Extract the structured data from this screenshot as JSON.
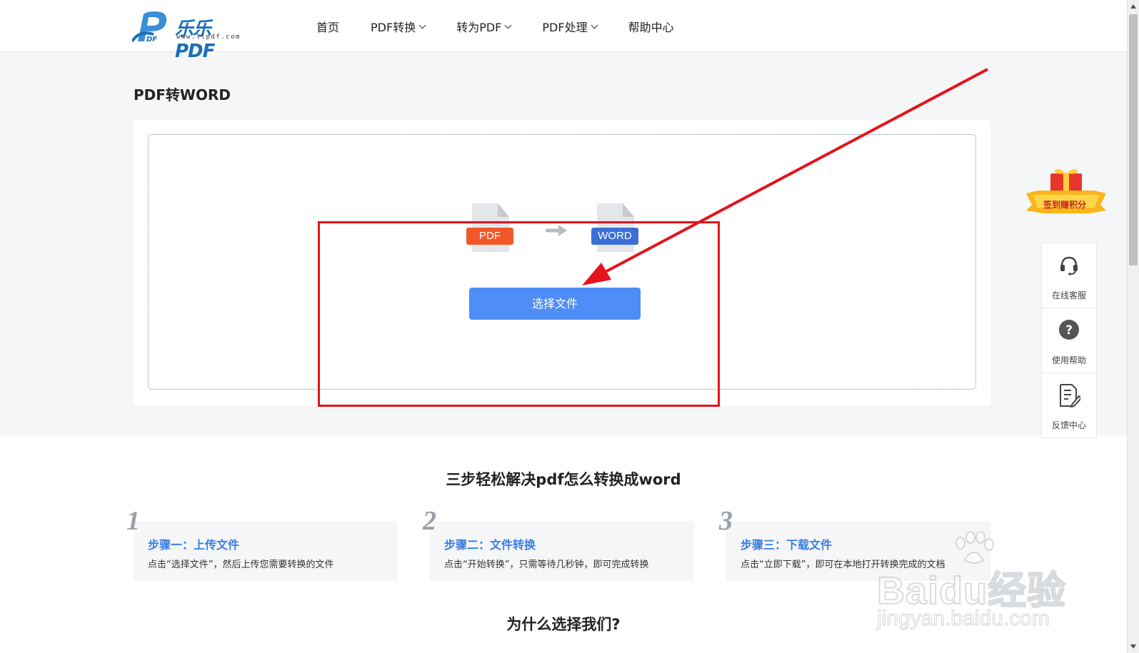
{
  "header": {
    "logo_text": "乐乐PDF",
    "logo_sub": "www.llpdf.com",
    "nav": [
      {
        "label": "首页",
        "has_dropdown": false
      },
      {
        "label": "PDF转换",
        "has_dropdown": true
      },
      {
        "label": "转为PDF",
        "has_dropdown": true
      },
      {
        "label": "PDF处理",
        "has_dropdown": true
      },
      {
        "label": "帮助中心",
        "has_dropdown": false
      }
    ]
  },
  "main": {
    "title": "PDF转WORD",
    "from_format": "PDF",
    "to_format": "WORD",
    "choose_button": "选择文件"
  },
  "steps": {
    "heading": "三步轻松解决pdf怎么转换成word",
    "items": [
      {
        "num": "1",
        "title": "步骤一：上传文件",
        "desc": "点击“选择文件”，然后上传您需要转换的文件"
      },
      {
        "num": "2",
        "title": "步骤二：文件转换",
        "desc": "点击“开始转换”，只需等待几秒钟，即可完成转换"
      },
      {
        "num": "3",
        "title": "步骤三：下载文件",
        "desc": "点击“立即下载”，即可在本地打开转换完成的文档"
      }
    ]
  },
  "why_heading": "为什么选择我们?",
  "side": {
    "gift_label": "签到赚积分",
    "items": [
      {
        "label": "在线客服",
        "icon": "headset-icon"
      },
      {
        "label": "使用帮助",
        "icon": "question-icon"
      },
      {
        "label": "反馈中心",
        "icon": "feedback-icon"
      }
    ]
  },
  "watermark": {
    "text": "Baidu经验",
    "url": "jingyan.baidu.com"
  },
  "colors": {
    "primary_blue": "#4f8ef7",
    "pdf_orange": "#f2572a",
    "word_blue": "#3b6fd6",
    "annotation_red": "#e3141b",
    "step_title_blue": "#3a7de0"
  }
}
